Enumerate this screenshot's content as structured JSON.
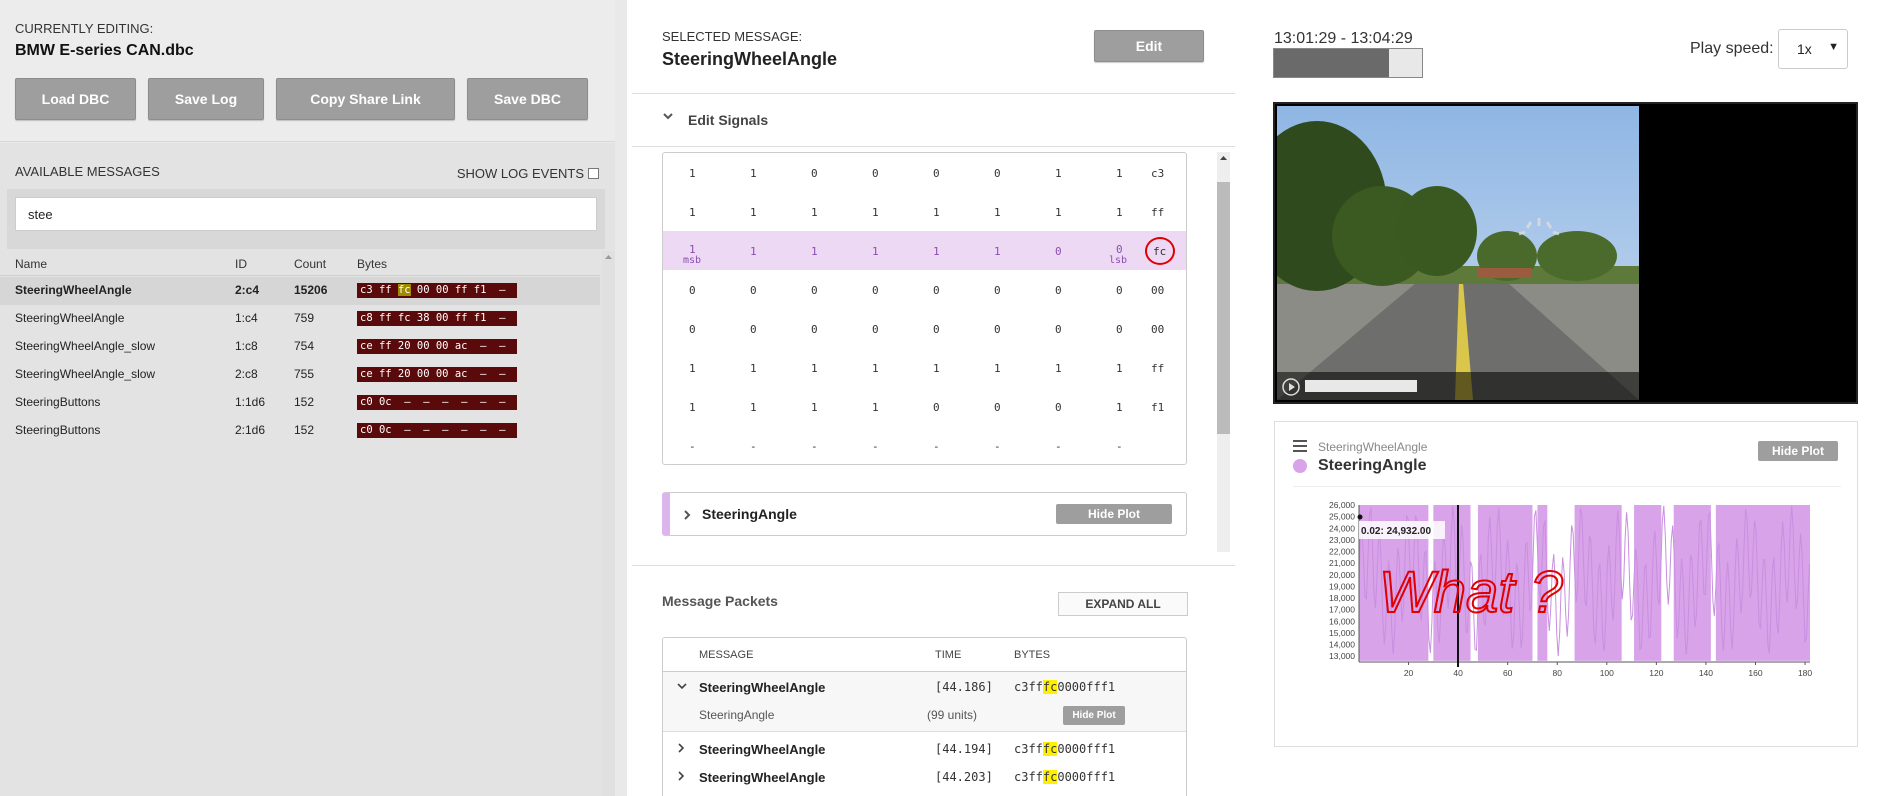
{
  "left": {
    "current_label": "CURRENTLY EDITING:",
    "current_file": "BMW E-series CAN.dbc",
    "buttons": {
      "load": "Load DBC",
      "save_log": "Save Log",
      "share": "Copy Share Link",
      "save_dbc": "Save DBC"
    },
    "available_label": "AVAILABLE MESSAGES",
    "show_log_label": "SHOW LOG EVENTS",
    "search_value": "stee",
    "columns": {
      "name": "Name",
      "id": "ID",
      "count": "Count",
      "bytes": "Bytes"
    },
    "rows": [
      {
        "name": "SteeringWheelAngle",
        "id": "2:c4",
        "count": "15206",
        "b1": "c3 ff ",
        "bh": "fc",
        "b2": " 00 00 ff f1  –"
      },
      {
        "name": "SteeringWheelAngle",
        "id": "1:c4",
        "count": "759",
        "b1": "c8 ff fc 38 00 ff f1  –",
        "bh": "",
        "b2": ""
      },
      {
        "name": "SteeringWheelAngle_slow",
        "id": "1:c8",
        "count": "754",
        "b1": "ce ff 20 00 00 ac  –  –",
        "bh": "",
        "b2": ""
      },
      {
        "name": "SteeringWheelAngle_slow",
        "id": "2:c8",
        "count": "755",
        "b1": "ce ff 20 00 00 ac  –  –",
        "bh": "",
        "b2": ""
      },
      {
        "name": "SteeringButtons",
        "id": "1:1d6",
        "count": "152",
        "b1": "c0 0c  –  –  –  –  –  –",
        "bh": "",
        "b2": ""
      },
      {
        "name": "SteeringButtons",
        "id": "2:1d6",
        "count": "152",
        "b1": "c0 0c  –  –  –  –  –  –",
        "bh": "",
        "b2": ""
      }
    ]
  },
  "center": {
    "selected_label": "SELECTED MESSAGE:",
    "selected_name": "SteeringWheelAngle",
    "edit_button": "Edit",
    "edit_signals": "Edit Signals",
    "bit_rows": [
      {
        "bits": [
          "1",
          "1",
          "0",
          "0",
          "0",
          "0",
          "1",
          "1"
        ],
        "hex": "c3"
      },
      {
        "bits": [
          "1",
          "1",
          "1",
          "1",
          "1",
          "1",
          "1",
          "1"
        ],
        "hex": "ff"
      },
      {
        "bits": [
          "1",
          "1",
          "1",
          "1",
          "1",
          "1",
          "0",
          "0"
        ],
        "hex": "fc"
      },
      {
        "bits": [
          "0",
          "0",
          "0",
          "0",
          "0",
          "0",
          "0",
          "0"
        ],
        "hex": "00"
      },
      {
        "bits": [
          "0",
          "0",
          "0",
          "0",
          "0",
          "0",
          "0",
          "0"
        ],
        "hex": "00"
      },
      {
        "bits": [
          "1",
          "1",
          "1",
          "1",
          "1",
          "1",
          "1",
          "1"
        ],
        "hex": "ff"
      },
      {
        "bits": [
          "1",
          "1",
          "1",
          "1",
          "0",
          "0",
          "0",
          "1"
        ],
        "hex": "f1"
      },
      {
        "bits": [
          "-",
          "-",
          "-",
          "-",
          "-",
          "-",
          "-",
          "-"
        ],
        "hex": ""
      }
    ],
    "msb": "msb",
    "lsb": "lsb",
    "signal_name": "SteeringAngle",
    "hide_plot": "Hide Plot",
    "packets_title": "Message Packets",
    "expand_all": "EXPAND ALL",
    "packet_cols": {
      "message": "MESSAGE",
      "time": "TIME",
      "bytes": "BYTES"
    },
    "packets": [
      {
        "name": "SteeringWheelAngle",
        "time": "[44.186]",
        "b1": "c3ff",
        "bh": "fc",
        "b2": "0000fff1"
      },
      {
        "name": "SteeringWheelAngle",
        "time": "[44.194]",
        "b1": "c3ff",
        "bh": "fc",
        "b2": "0000fff1"
      },
      {
        "name": "SteeringWheelAngle",
        "time": "[44.203]",
        "b1": "c3ff",
        "bh": "fc",
        "b2": "0000fff1"
      }
    ],
    "packet_signal": {
      "name": "SteeringAngle",
      "value": "(99 units)",
      "button": "Hide Plot"
    }
  },
  "right": {
    "time_range": "13:01:29 - 13:04:29",
    "progress": 0.78,
    "play_speed_label": "Play speed:",
    "play_speed_value": "1x",
    "plot_message": "SteeringWheelAngle",
    "plot_signal": "SteeringAngle",
    "plot_hide": "Hide Plot",
    "tooltip": "0.02: 24,932.00",
    "annotation": "What ?",
    "signal_color": "#d8a3e8",
    "annotation_color": "#e00000"
  },
  "chart_data": {
    "type": "line",
    "series": [
      {
        "name": "SteeringAngle",
        "color": "#d8a3e8"
      }
    ],
    "x_ticks": [
      20,
      40,
      60,
      80,
      100,
      120,
      140,
      160,
      180
    ],
    "y_ticks": [
      "13,000",
      "14,000",
      "15,000",
      "16,000",
      "17,000",
      "18,000",
      "19,000",
      "20,000",
      "21,000",
      "22,000",
      "23,000",
      "24,000",
      "25,000",
      "26,000"
    ],
    "xlim": [
      0,
      182
    ],
    "ylim": [
      12500,
      26000
    ],
    "grid": false
  }
}
